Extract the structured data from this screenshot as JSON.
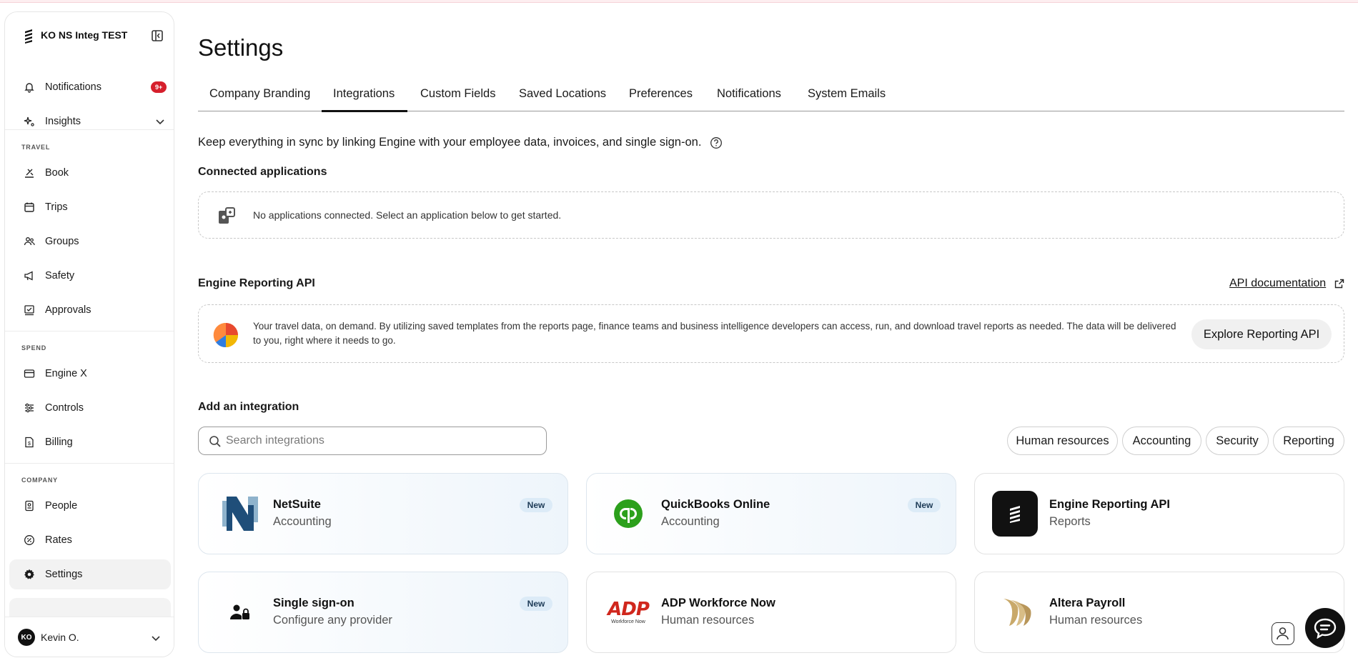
{
  "sidebar": {
    "company": "KO NS Integ TEST",
    "items_top": [
      {
        "label": "Notifications",
        "badge": "9+"
      },
      {
        "label": "Insights"
      }
    ],
    "sections": {
      "travel": "TRAVEL",
      "spend": "SPEND",
      "company": "COMPANY"
    },
    "travel_items": [
      "Book",
      "Trips",
      "Groups",
      "Safety",
      "Approvals"
    ],
    "spend_items": [
      "Engine X",
      "Controls",
      "Billing"
    ],
    "company_items": [
      "People",
      "Rates",
      "Settings"
    ],
    "user": {
      "initials": "KO",
      "name": "Kevin O."
    }
  },
  "page": {
    "title": "Settings",
    "tabs": [
      "Company Branding",
      "Integrations",
      "Custom Fields",
      "Saved Locations",
      "Preferences",
      "Notifications",
      "System Emails"
    ],
    "active_tab": "Integrations",
    "intro": "Keep everything in sync by linking Engine with your employee data, invoices, and single sign-on."
  },
  "connected": {
    "title": "Connected applications",
    "empty_text": "No applications connected. Select an application below to get started."
  },
  "reporting": {
    "title": "Engine Reporting API",
    "doc_link": "API documentation",
    "description": "Your travel data, on demand. By utilizing saved templates from the reports page, finance teams and business intelligence developers can access, run, and download travel reports as needed. The data will be delivered to you, right where it needs to go.",
    "button": "Explore Reporting API"
  },
  "integrations": {
    "title": "Add an integration",
    "search_placeholder": "Search integrations",
    "filters": [
      "Human resources",
      "Accounting",
      "Security",
      "Reporting"
    ],
    "cards": [
      {
        "name": "NetSuite",
        "category": "Accounting",
        "badge": "New",
        "logo": "netsuite-logo"
      },
      {
        "name": "QuickBooks Online",
        "category": "Accounting",
        "badge": "New",
        "logo": "quickbooks-logo"
      },
      {
        "name": "Engine Reporting API",
        "category": "Reports",
        "badge": "",
        "logo": "engine-logo"
      },
      {
        "name": "Single sign-on",
        "category": "Configure any provider",
        "badge": "New",
        "logo": "user-lock-icon"
      },
      {
        "name": "ADP Workforce Now",
        "category": "Human resources",
        "badge": "",
        "logo": "adp-logo",
        "logo_text": "ADP",
        "logo_subtext": "Workforce Now"
      },
      {
        "name": "Altera Payroll",
        "category": "Human resources",
        "badge": "",
        "logo": "altera-logo"
      }
    ]
  },
  "colors": {
    "accent": "#111111",
    "badge_red": "#d61f2c",
    "new_badge_bg": "#dcebf7",
    "quickbooks_green": "#2ca01c",
    "adp_red": "#d0271d",
    "altera_gold": "#c9a96a",
    "netsuite_blue": "#1f4e79"
  }
}
